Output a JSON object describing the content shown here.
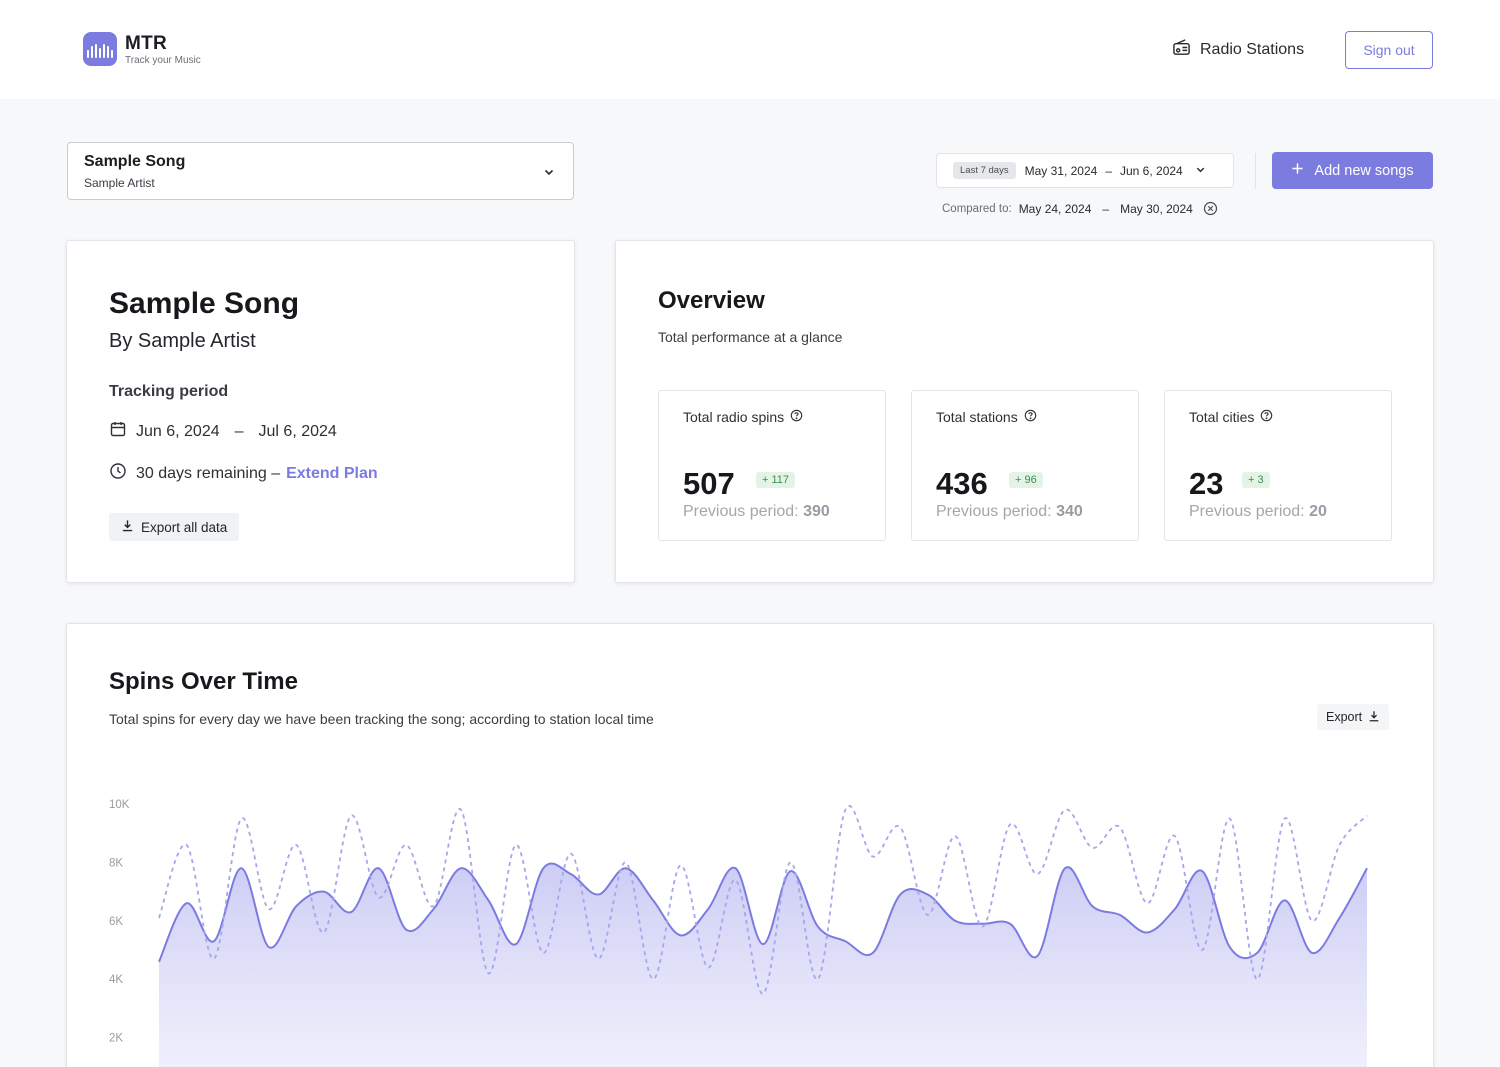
{
  "app": {
    "name": "MTR",
    "tagline": "Track your Music",
    "accent_color": "#7b7be0"
  },
  "nav": {
    "radio_stations_label": "Radio Stations",
    "sign_out_label": "Sign out"
  },
  "song_selector": {
    "title": "Sample Song",
    "artist": "Sample Artist"
  },
  "date_filter": {
    "preset": "Last 7 days",
    "start": "May 31, 2024",
    "separator": "–",
    "end": "Jun 6, 2024",
    "compared_label": "Compared to:",
    "compare_start": "May 24, 2024",
    "compare_end": "May 30, 2024"
  },
  "add_songs_label": "Add new songs",
  "song_card": {
    "title": "Sample Song",
    "by_line": "By Sample Artist",
    "tracking_label": "Tracking period",
    "tracking_start": "Jun 6, 2024",
    "tracking_separator": "–",
    "tracking_end": "Jul 6, 2024",
    "remaining_text": "30 days remaining –",
    "extend_label": "Extend Plan",
    "export_label": "Export all data"
  },
  "overview": {
    "title": "Overview",
    "subtitle": "Total performance at a glance",
    "stats": [
      {
        "label": "Total radio spins",
        "value": "507",
        "delta": "+ 117",
        "prev_label": "Previous period:",
        "prev_value": "390"
      },
      {
        "label": "Total stations",
        "value": "436",
        "delta": "+ 96",
        "prev_label": "Previous period:",
        "prev_value": "340"
      },
      {
        "label": "Total cities",
        "value": "23",
        "delta": "+ 3",
        "prev_label": "Previous period:",
        "prev_value": "20"
      }
    ]
  },
  "spins": {
    "title": "Spins Over Time",
    "subtitle": "Total spins for every day we have been tracking the song; according to station local time",
    "export_label": "Export"
  },
  "chart_data": {
    "type": "area",
    "title": "Spins Over Time",
    "ylim": [
      0,
      10000
    ],
    "y_ticks": [
      "2K",
      "4K",
      "6K",
      "8K",
      "10K"
    ],
    "grid": false,
    "series": [
      {
        "style": "area",
        "color": "#7b7be0",
        "values": [
          4600,
          6600,
          5300,
          7800,
          5100,
          6500,
          7000,
          6300,
          7800,
          5700,
          6400,
          7800,
          6700,
          5200,
          7800,
          7600,
          6900,
          7800,
          6700,
          5500,
          6400,
          7800,
          5200,
          7700,
          5800,
          5300,
          4900,
          6900,
          6900,
          6000,
          5900,
          5900,
          4800,
          7800,
          6500,
          6200,
          5600,
          6400,
          7700,
          5100,
          4900,
          6700,
          4900,
          6100,
          7800
        ]
      },
      {
        "style": "dashed",
        "color": "#a6a6ee",
        "values": [
          6100,
          8600,
          4700,
          9500,
          6400,
          8600,
          5600,
          9600,
          6800,
          8600,
          6500,
          9800,
          4200,
          8600,
          4900,
          8300,
          4700,
          8000,
          4000,
          7900,
          4400,
          7400,
          3500,
          8000,
          4000,
          9800,
          8200,
          9200,
          6200,
          8900,
          5800,
          9300,
          7600,
          9800,
          8500,
          9200,
          6600,
          8900,
          5000,
          9500,
          4000,
          9500,
          6000,
          8600,
          9600
        ]
      }
    ]
  }
}
